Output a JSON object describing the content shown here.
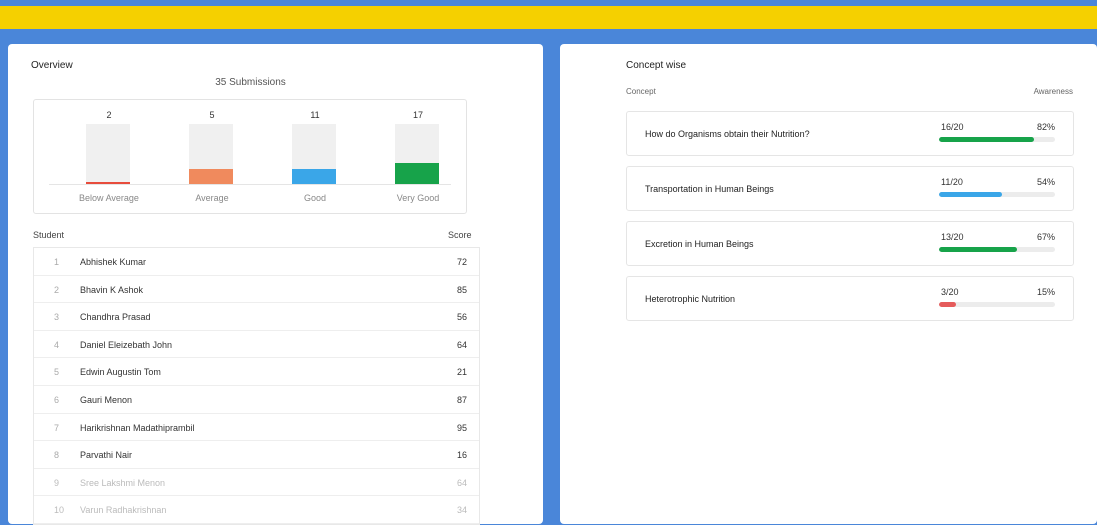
{
  "overview": {
    "title": "Overview",
    "submissions": "35 Submissions",
    "bands": [
      {
        "label": "Below Average",
        "count": "2",
        "fraction": 0.04,
        "color": "#e74c3c"
      },
      {
        "label": "Average",
        "count": "5",
        "fraction": 0.25,
        "color": "#f08a5d"
      },
      {
        "label": "Good",
        "count": "11",
        "fraction": 0.25,
        "color": "#3aa6e8"
      },
      {
        "label": "Very Good",
        "count": "17",
        "fraction": 0.35,
        "color": "#17a34a"
      }
    ]
  },
  "students": {
    "header_student": "Student",
    "header_score": "Score",
    "rows": [
      {
        "num": "1",
        "name": "Abhishek Kumar",
        "score": "72"
      },
      {
        "num": "2",
        "name": "Bhavin K Ashok",
        "score": "85"
      },
      {
        "num": "3",
        "name": "Chandhra Prasad",
        "score": "56"
      },
      {
        "num": "4",
        "name": "Daniel Eleizebath John",
        "score": "64"
      },
      {
        "num": "5",
        "name": "Edwin Augustin Tom",
        "score": "21"
      },
      {
        "num": "6",
        "name": "Gauri Menon",
        "score": "87"
      },
      {
        "num": "7",
        "name": "Harikrishnan Madathiprambil",
        "score": "95"
      },
      {
        "num": "8",
        "name": "Parvathi Nair",
        "score": "16"
      },
      {
        "num": "9",
        "name": "Sree Lakshmi Menon",
        "score": "64"
      },
      {
        "num": "10",
        "name": "Varun Radhakrishnan",
        "score": "34"
      }
    ]
  },
  "concepts": {
    "title": "Concept wise",
    "header_concept": "Concept",
    "header_awareness": "Awareness",
    "items": [
      {
        "name": "How do Organisms obtain their Nutrition?",
        "fraction": "16/20",
        "percent": "82%",
        "level": 0.82,
        "color": "#17a34a"
      },
      {
        "name": "Transportation in Human Beings",
        "fraction": "11/20",
        "percent": "54%",
        "level": 0.54,
        "color": "#3aa6e8"
      },
      {
        "name": "Excretion in Human Beings",
        "fraction": "13/20",
        "percent": "67%",
        "level": 0.67,
        "color": "#17a34a"
      },
      {
        "name": "Heterotrophic Nutrition",
        "fraction": "3/20",
        "percent": "15%",
        "level": 0.15,
        "color": "#e55b5b"
      }
    ]
  }
}
